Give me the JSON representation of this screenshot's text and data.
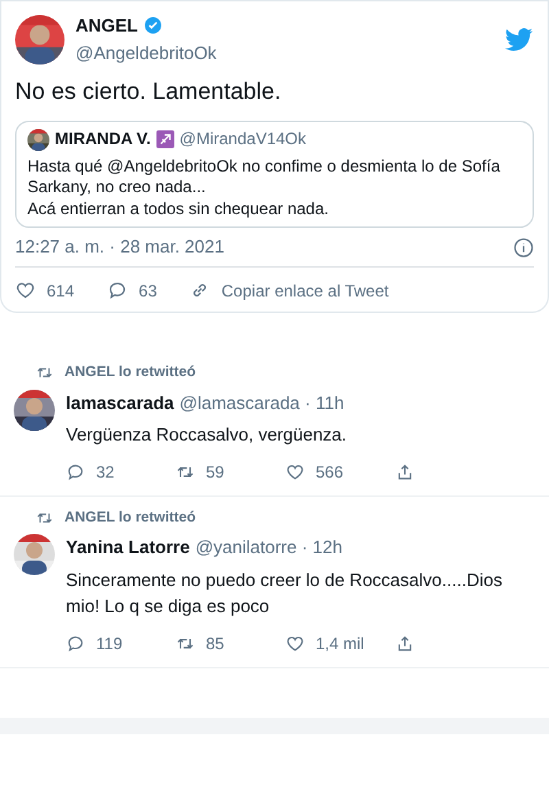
{
  "tweet": {
    "name": "ANGEL",
    "verified": true,
    "handle": "@AngeldebritoOk",
    "text": "No es cierto. Lamentable.",
    "quote": {
      "name": "MIRANDA V.",
      "handle": "@MirandaV14Ok",
      "text": "Hasta qué @AngeldebritoOk no confime o desmienta lo de Sofía Sarkany, no creo nada...\nAcá entierran a todos sin chequear nada."
    },
    "time": "12:27 a. m. · 28 mar. 2021",
    "likes": "614",
    "replies": "63",
    "copy_link": "Copiar enlace al Tweet"
  },
  "retweets": [
    {
      "retweeted_by": "ANGEL lo retwitteó",
      "name": "lamascarada",
      "handle": "@lamascarada · 11h",
      "text": "Vergüenza Roccasalvo, vergüenza.",
      "replies": "32",
      "retweets": "59",
      "likes": "566"
    },
    {
      "retweeted_by": "ANGEL lo retwitteó",
      "name": "Yanina Latorre",
      "handle": "@yanilatorre · 12h",
      "text": "Sinceramente no puedo creer lo de Roccasalvo.....Dios mio! Lo q se diga es poco",
      "replies": "119",
      "retweets": "85",
      "likes": "1,4 mil"
    }
  ]
}
